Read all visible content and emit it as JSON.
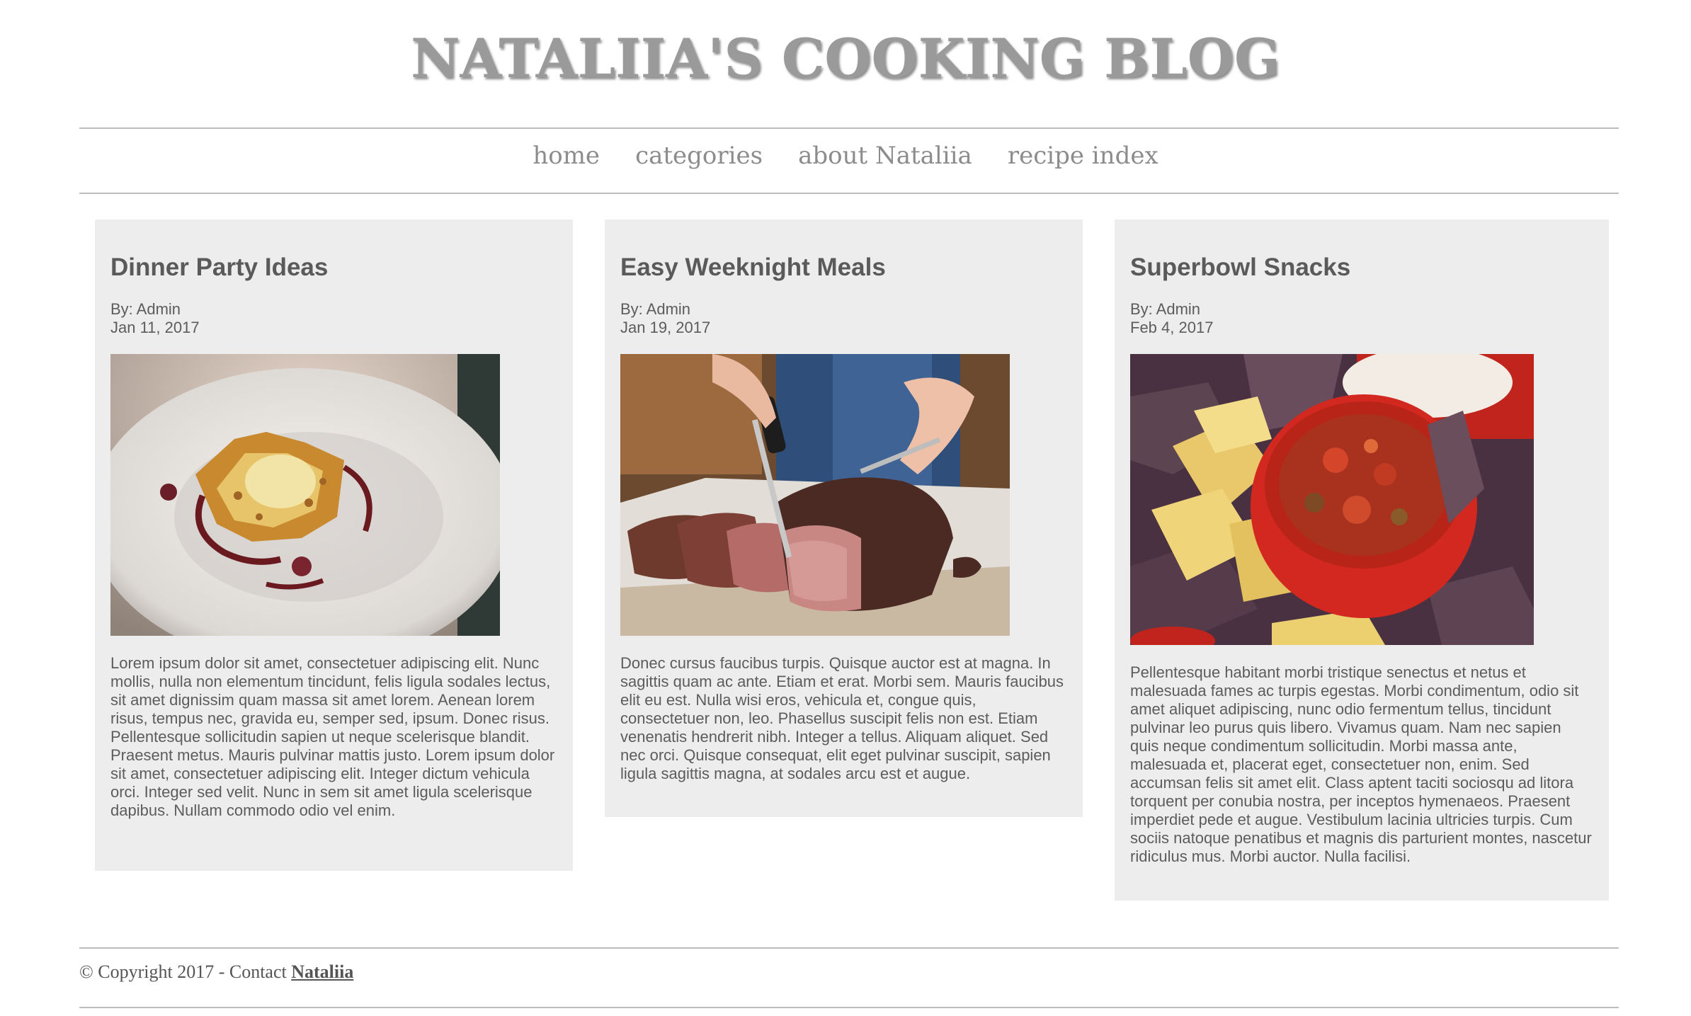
{
  "site": {
    "title": "NATALIIA'S COOKING BLOG"
  },
  "nav": {
    "home": "home",
    "categories": "categories",
    "about": "about Nataliia",
    "recipe_index": "recipe index"
  },
  "posts": [
    {
      "title": "Dinner Party Ideas",
      "author": "By: Admin",
      "date": "Jan 11, 2017",
      "image_icon": "plated-dessert-photo",
      "text": "Lorem ipsum dolor sit amet, consectetuer adipiscing elit. Nunc mollis, nulla non elementum tincidunt, felis ligula sodales lectus, sit amet dignissim quam massa sit amet lorem. Aenean lorem risus, tempus nec, gravida eu, semper sed, ipsum. Donec risus. Pellentesque sollicitudin sapien ut neque scelerisque blandit. Praesent metus. Mauris pulvinar mattis justo. Lorem ipsum dolor sit amet, consectetuer adipiscing elit. Integer dictum vehicula orci. Integer sed velit. Nunc in sem sit amet ligula scelerisque dapibus. Nullam commodo odio vel enim."
    },
    {
      "title": "Easy Weeknight Meals",
      "author": "By: Admin",
      "date": "Jan 19, 2017",
      "image_icon": "sliced-steak-photo",
      "text": "Donec cursus faucibus turpis. Quisque auctor est at magna. In sagittis quam ac ante. Etiam et erat. Morbi sem. Mauris faucibus elit eu est. Nulla wisi eros, vehicula et, congue quis, consectetuer non, leo. Phasellus suscipit felis non est. Etiam venenatis hendrerit nibh. Integer a tellus. Aliquam aliquet. Sed nec orci. Quisque consequat, elit eget pulvinar suscipit, sapien ligula sagittis magna, at sodales arcu est et augue."
    },
    {
      "title": "Superbowl Snacks",
      "author": "By: Admin",
      "date": "Feb 4, 2017",
      "image_icon": "chips-and-salsa-photo",
      "text": "Pellentesque habitant morbi tristique senectus et netus et malesuada fames ac turpis egestas. Morbi condimentum, odio sit amet aliquet adipiscing, nunc odio fermentum tellus, tincidunt pulvinar leo purus quis libero. Vivamus quam. Nam nec sapien quis neque condimentum sollicitudin. Morbi massa ante, malesuada et, placerat eget, consectetuer non, enim. Sed accumsan felis sit amet elit. Class aptent taciti sociosqu ad litora torquent per conubia nostra, per inceptos hymenaeos. Praesent imperdiet pede et augue. Vestibulum lacinia ultricies turpis. Cum sociis natoque penatibus et magnis dis parturient montes, nascetur ridiculus mus. Morbi auctor. Nulla facilisi."
    }
  ],
  "footer": {
    "copyright": "© Copyright 2017 - Contact ",
    "contact_link": "Nataliia"
  },
  "colors": {
    "title": "#9a9a9a",
    "nav": "#8c8c8c",
    "card_bg": "#ededed",
    "text": "#5c5c5c",
    "rule": "#bdbdbd"
  }
}
